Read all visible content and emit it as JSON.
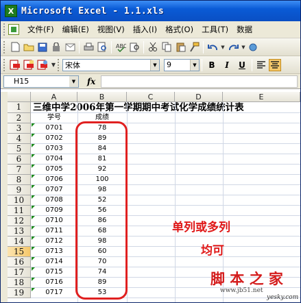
{
  "window": {
    "title": "Microsoft Excel - 1.1.xls",
    "app_icon": "X"
  },
  "menu": {
    "items": [
      "文件(F)",
      "编辑(E)",
      "视图(V)",
      "插入(I)",
      "格式(O)",
      "工具(T)",
      "数据"
    ]
  },
  "toolbar2": {
    "font_name": "宋体",
    "font_size": "9",
    "bold": "B",
    "italic": "I",
    "underline": "U"
  },
  "formula_bar": {
    "name_box": "H15",
    "fx_label": "fx",
    "formula": ""
  },
  "grid": {
    "columns": [
      "A",
      "B",
      "C",
      "D",
      "E"
    ],
    "selected_column": "",
    "selected_row": "15",
    "title_text": "三维中学2006年第一学期期中考试化学成绩统计表",
    "header_row": {
      "a": "学号",
      "b": "成绩"
    },
    "row_numbers": [
      "1",
      "2",
      "3",
      "4",
      "5",
      "6",
      "7",
      "8",
      "9",
      "10",
      "11",
      "12",
      "13",
      "14",
      "15",
      "16",
      "17",
      "18",
      "19"
    ],
    "rows": [
      {
        "a": "0701",
        "b": "78"
      },
      {
        "a": "0702",
        "b": "89"
      },
      {
        "a": "0703",
        "b": "84"
      },
      {
        "a": "0704",
        "b": "81"
      },
      {
        "a": "0705",
        "b": "92"
      },
      {
        "a": "0706",
        "b": "100"
      },
      {
        "a": "0707",
        "b": "98"
      },
      {
        "a": "0708",
        "b": "52"
      },
      {
        "a": "0709",
        "b": "56"
      },
      {
        "a": "0710",
        "b": "86"
      },
      {
        "a": "0711",
        "b": "68"
      },
      {
        "a": "0712",
        "b": "98"
      },
      {
        "a": "0713",
        "b": "60"
      },
      {
        "a": "0714",
        "b": "70"
      },
      {
        "a": "0715",
        "b": "74"
      },
      {
        "a": "0716",
        "b": "89"
      },
      {
        "a": "0717",
        "b": "53"
      }
    ]
  },
  "annotation": {
    "line1": "单列或多列",
    "line2": "均可"
  },
  "watermark": {
    "cn": "脚 本 之 家",
    "url": "www.jb51.net",
    "site": "yesky.com"
  },
  "colors": {
    "accent": "#e01818",
    "title_blue": "#0a5bd6",
    "selection": "#f6c86a"
  }
}
